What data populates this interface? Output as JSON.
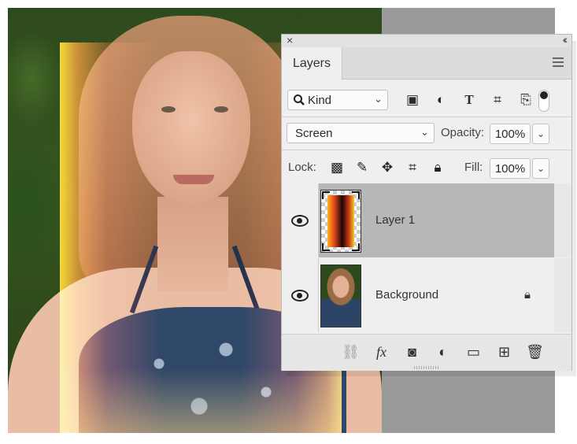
{
  "panel": {
    "close_icon": "×",
    "collapse_icon": "‹‹",
    "tab_label": "Layers",
    "filter": {
      "kind_icon": "search-icon",
      "kind_label": "Kind",
      "icons": [
        "image-filter-icon",
        "adjustment-filter-icon",
        "type-filter-icon",
        "shape-filter-icon",
        "smart-object-filter-icon"
      ]
    },
    "blend": {
      "mode": "Screen",
      "opacity_label": "Opacity:",
      "opacity_value": "100%"
    },
    "lock": {
      "label": "Lock:",
      "icons": [
        "lock-transparent-pixels-icon",
        "lock-image-pixels-icon",
        "lock-position-icon",
        "prevent-auto-nesting-icon",
        "lock-all-icon"
      ],
      "fill_label": "Fill:",
      "fill_value": "100%"
    },
    "layers": [
      {
        "name": "Layer 1",
        "visible": true,
        "selected": true,
        "locked": false
      },
      {
        "name": "Background",
        "visible": true,
        "selected": false,
        "locked": true
      }
    ],
    "bottom_icons": [
      "link-layers-icon",
      "fx-icon",
      "add-mask-icon",
      "adjustment-layer-icon",
      "new-group-icon",
      "new-layer-icon",
      "delete-icon"
    ]
  },
  "colors": {
    "panel_bg": "#efefef",
    "selected_layer": "#b7b7b7",
    "gradient_stops": [
      "#f9b41d",
      "#e3481c",
      "#200605",
      "#c83a12",
      "#fbc625"
    ]
  }
}
